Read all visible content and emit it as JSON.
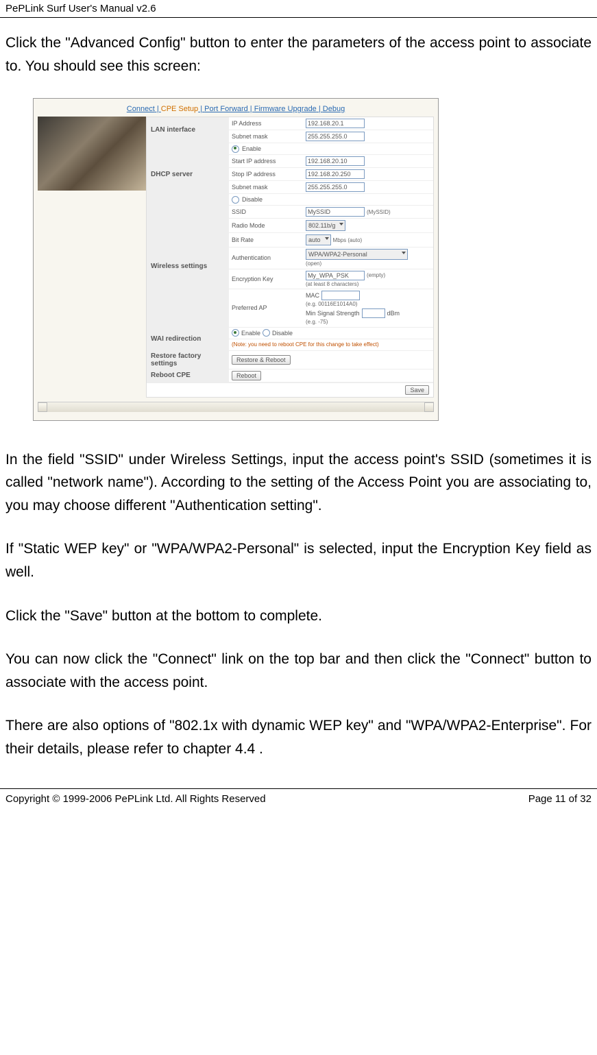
{
  "header": {
    "title": "PePLink Surf User's Manual v2.6"
  },
  "body": {
    "p1": "Click the \"Advanced Config\" button to enter the parameters of the access point to associate to.    You should see this screen:",
    "p2": "In the field \"SSID\" under Wireless Settings, input the access point's SSID (sometimes it is called \"network name\").  According to the setting of the Access Point you are associating to, you may choose different \"Authentication setting\".",
    "p3": "If \"Static WEP key\" or \"WPA/WPA2-Personal\" is selected, input the Encryption Key field as well.",
    "p4": "Click the \"Save\" button at the bottom to complete.",
    "p5": "You can now click the \"Connect\" link on the top bar and then click the \"Connect\" button to associate with the access point.",
    "p6": "There are also options of \"802.1x with dynamic WEP key\" and \"WPA/WPA2-Enterprise\".    For their details, please refer to chapter 4.4 ."
  },
  "screenshot": {
    "nav": {
      "connect": "Connect",
      "cpe": "CPE Setup",
      "pf": "Port Forward",
      "fw": "Firmware Upgrade",
      "dbg": "Debug",
      "sep": " | "
    },
    "sections": {
      "lan": {
        "title": "LAN interface",
        "ip_label": "IP Address",
        "ip_value": "192.168.20.1",
        "mask_label": "Subnet mask",
        "mask_value": "255.255.255.0"
      },
      "dhcp": {
        "title": "DHCP server",
        "enable": "Enable",
        "start_label": "Start IP address",
        "start_value": "192.168.20.10",
        "stop_label": "Stop IP address",
        "stop_value": "192.168.20.250",
        "mask_label": "Subnet mask",
        "mask_value": "255.255.255.0",
        "disable": "Disable"
      },
      "wireless": {
        "title": "Wireless settings",
        "ssid_label": "SSID",
        "ssid_value": "MySSID",
        "ssid_hint": "(MySSID)",
        "radio_label": "Radio Mode",
        "radio_value": "802.11b/g",
        "bitrate_label": "Bit Rate",
        "bitrate_value": "auto",
        "bitrate_hint": "Mbps (auto)",
        "auth_label": "Authentication",
        "auth_value": "WPA/WPA2-Personal",
        "auth_hint": "(open)",
        "enc_label": "Encryption Key",
        "enc_value": "My_WPA_PSK",
        "enc_hint": "(empty)",
        "enc_note": "(at least 8 characters)",
        "pref_label": "Preferred AP",
        "pref_mac": "MAC",
        "pref_eg1": "(e.g. 00116E1014A0)",
        "pref_min": "Min Signal Strength",
        "pref_dbm": "dBm",
        "pref_eg2": "(e.g. -75)"
      },
      "wai": {
        "title": "WAI redirection",
        "enable": "Enable",
        "disable": "Disable",
        "note": "(Note: you need to reboot CPE for this change to take effect)"
      },
      "restore": {
        "title": "Restore factory settings",
        "btn": "Restore & Reboot"
      },
      "reboot": {
        "title": "Reboot CPE",
        "btn": "Reboot"
      },
      "save": "Save"
    }
  },
  "footer": {
    "left": "Copyright © 1999-2006 PePLink Ltd. All Rights Reserved",
    "right": "Page 11 of 32"
  }
}
